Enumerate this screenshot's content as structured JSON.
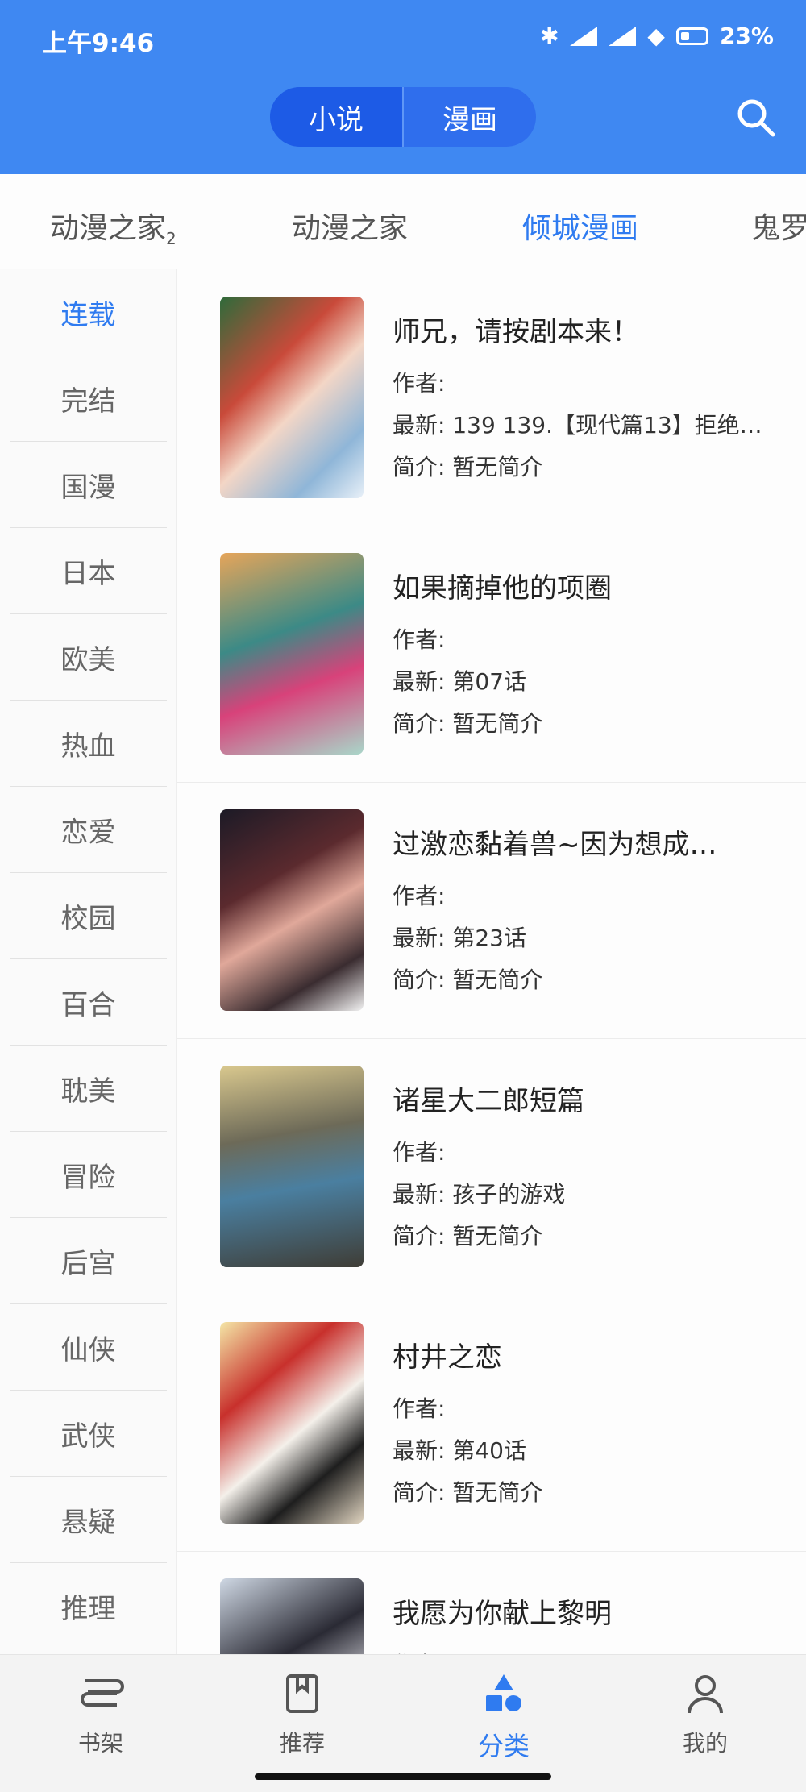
{
  "status": {
    "time": "上午9:46",
    "battery": "23%"
  },
  "header": {
    "segments": [
      "小说",
      "漫画"
    ],
    "active_segment": 0
  },
  "source_tabs": [
    {
      "label": "动漫之家",
      "sub": "2"
    },
    {
      "label": "动漫之家",
      "sub": ""
    },
    {
      "label": "倾城漫画",
      "sub": ""
    },
    {
      "label": "鬼罗",
      "sub": ""
    }
  ],
  "categories": [
    "连载",
    "完结",
    "国漫",
    "日本",
    "欧美",
    "热血",
    "恋爱",
    "校园",
    "百合",
    "耽美",
    "冒险",
    "后宫",
    "仙侠",
    "武侠",
    "悬疑",
    "推理"
  ],
  "books": [
    {
      "title": "师兄，请按剧本来！",
      "author": "作者:",
      "latest": "最新: 139 139.【现代篇13】拒绝…",
      "intro": "简介: 暂无简介"
    },
    {
      "title": "如果摘掉他的项圈",
      "author": "作者:",
      "latest": "最新: 第07话",
      "intro": "简介: 暂无简介"
    },
    {
      "title": "过激恋黏着兽~因为想成…",
      "author": "作者:",
      "latest": "最新: 第23话",
      "intro": "简介: 暂无简介"
    },
    {
      "title": "诸星大二郎短篇",
      "author": "作者:",
      "latest": "最新: 孩子的游戏",
      "intro": "简介: 暂无简介"
    },
    {
      "title": "村井之恋",
      "author": "作者:",
      "latest": "最新: 第40话",
      "intro": "简介: 暂无简介"
    },
    {
      "title": "我愿为你献上黎明",
      "author": "作者:",
      "latest": "",
      "intro": ""
    }
  ],
  "bottom_nav": [
    "书架",
    "推荐",
    "分类",
    "我的"
  ],
  "colors": {
    "primary": "#3f88f2",
    "accent": "#2f7bf0"
  }
}
